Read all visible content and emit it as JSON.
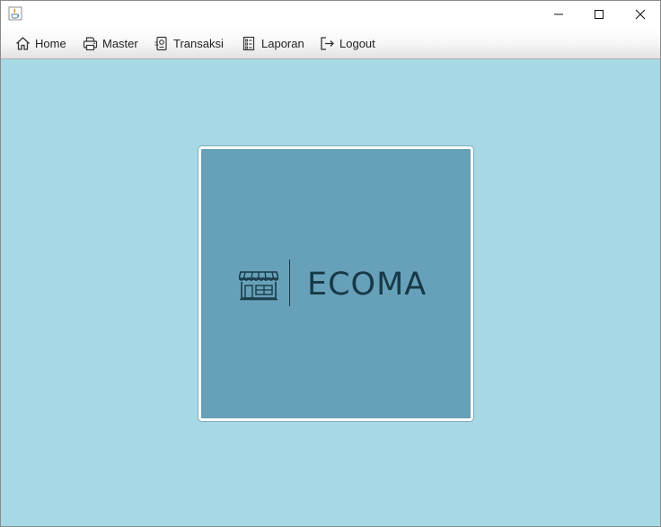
{
  "window": {
    "icons": {
      "app": "java-cup-icon",
      "minimize": "minimize-icon",
      "maximize": "maximize-icon",
      "close": "close-icon"
    }
  },
  "menu": [
    {
      "label": "Home",
      "icon": "home-icon"
    },
    {
      "label": "Master",
      "icon": "printer-icon"
    },
    {
      "label": "Transaksi",
      "icon": "transaction-icon"
    },
    {
      "label": "Laporan",
      "icon": "report-icon"
    },
    {
      "label": "Logout",
      "icon": "logout-icon"
    }
  ],
  "logo": {
    "text": "ECOMA",
    "icon": "storefront-icon"
  },
  "colors": {
    "background": "#a6d8e6",
    "card": "#67a0b9",
    "logo_ink": "#173946",
    "card_border": "#ffffff"
  }
}
